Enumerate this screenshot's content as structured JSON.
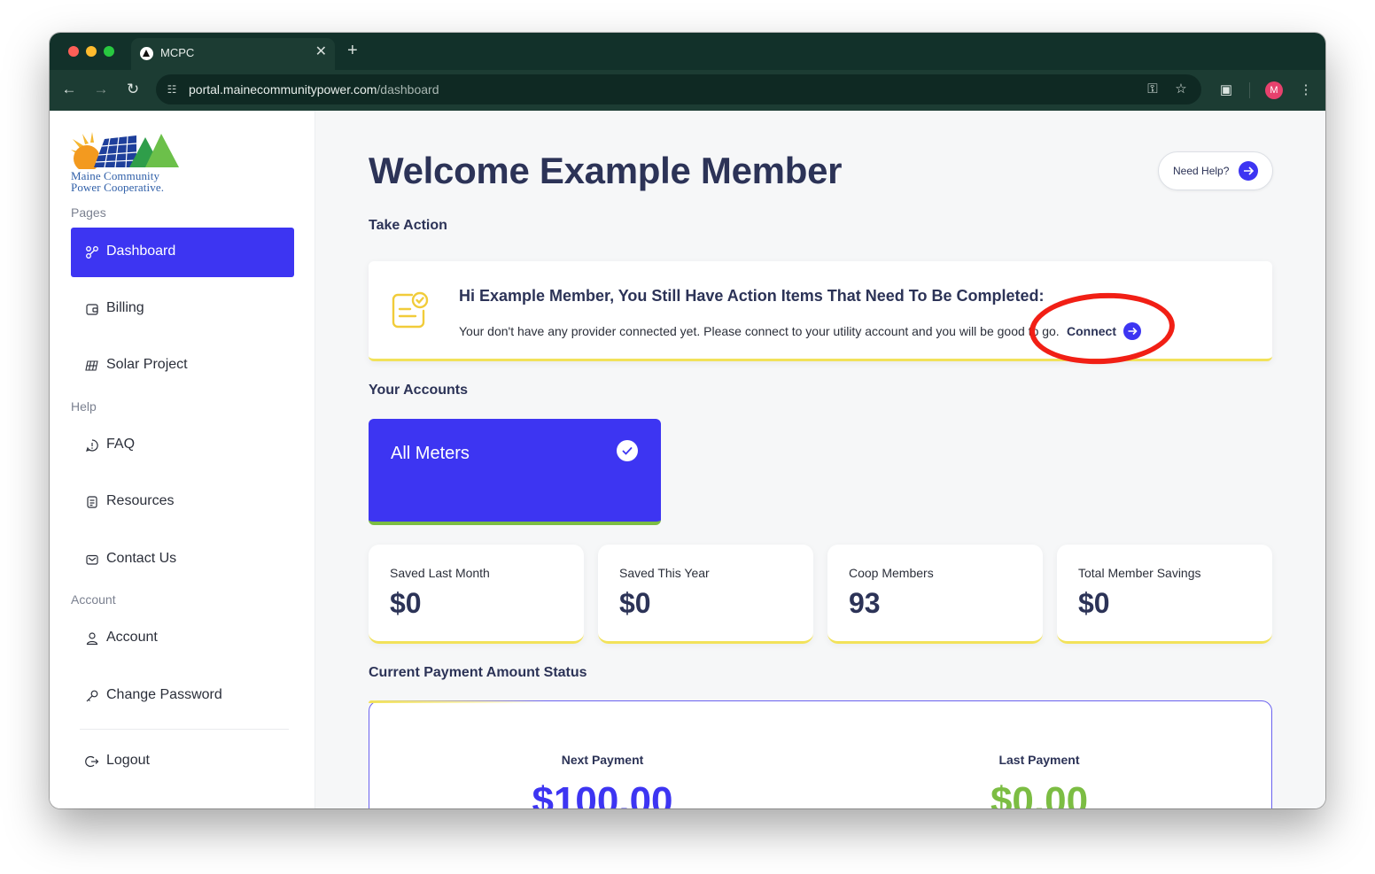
{
  "browser": {
    "tab_title": "MCPC",
    "url_host": "portal.mainecommunitypower.com",
    "url_path": "/dashboard",
    "profile_initial": "M"
  },
  "brand": {
    "logo_line1": "Maine Community",
    "logo_line2": "Power Cooperative.",
    "accent": "#3d35f2",
    "success": "#7cbd43",
    "highlight": "#f2e25a",
    "annotation": "#f11f15"
  },
  "sidebar": {
    "sections": {
      "pages": "Pages",
      "help": "Help",
      "account": "Account"
    },
    "items": [
      {
        "label": "Dashboard",
        "icon": "dashboard-icon"
      },
      {
        "label": "Billing",
        "icon": "wallet-icon"
      },
      {
        "label": "Solar Project",
        "icon": "solar-panel-icon"
      },
      {
        "label": "FAQ",
        "icon": "faq-icon"
      },
      {
        "label": "Resources",
        "icon": "document-icon"
      },
      {
        "label": "Contact Us",
        "icon": "mail-icon"
      },
      {
        "label": "Account",
        "icon": "user-icon"
      },
      {
        "label": "Change Password",
        "icon": "key-icon"
      },
      {
        "label": "Logout",
        "icon": "logout-icon"
      }
    ]
  },
  "main": {
    "welcome": "Welcome Example Member",
    "help_button": "Need Help?",
    "take_action_heading": "Take Action",
    "action_title": "Hi Example Member, You Still Have Action Items That Need To Be Completed:",
    "action_text": "Your don't have any provider connected yet. Please connect to your utility account and you will be good to go.",
    "connect_label": "Connect",
    "accounts_heading": "Your Accounts",
    "meter_label": "All Meters",
    "stats": [
      {
        "label": "Saved Last Month",
        "value": "$0"
      },
      {
        "label": "Saved This Year",
        "value": "$0"
      },
      {
        "label": "Coop Members",
        "value": "93"
      },
      {
        "label": "Total Member Savings",
        "value": "$0"
      }
    ],
    "payment_heading": "Current Payment Amount Status",
    "next_payment_label": "Next Payment",
    "next_payment_value": "$100.00",
    "last_payment_label": "Last Payment",
    "last_payment_value": "$0.00"
  }
}
